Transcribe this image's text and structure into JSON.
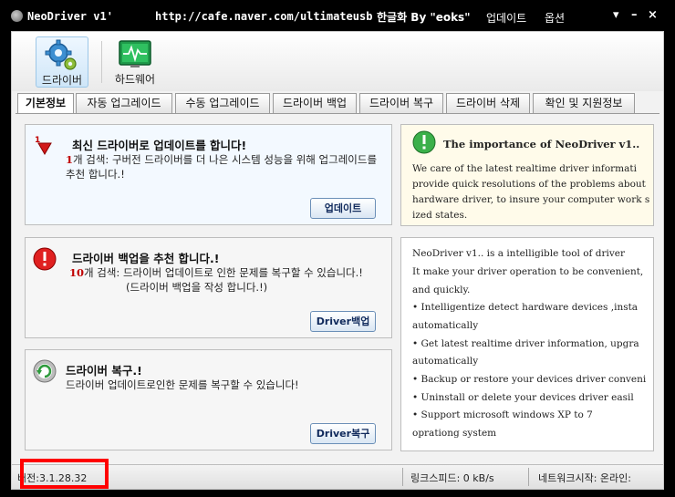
{
  "titlebar": {
    "app_name": "NeoDriver v1'",
    "url": "http://cafe.naver.com/ultimateusb",
    "credit": "한글화 By \"eoks\"",
    "menu_update": "업데이트",
    "menu_options": "옵션",
    "minimize_glyph": "▾",
    "dash_glyph": "–",
    "close_glyph": "×"
  },
  "toolbar": {
    "driver_label": "드라이버",
    "hardware_label": "하드웨어"
  },
  "tabs": [
    {
      "label": "기본정보",
      "active": true
    },
    {
      "label": "자동 업그레이드",
      "active": false
    },
    {
      "label": "수동 업그레이드",
      "active": false
    },
    {
      "label": "드라이버 백업",
      "active": false
    },
    {
      "label": "드라이버 복구",
      "active": false
    },
    {
      "label": "드라이버 삭제",
      "active": false
    },
    {
      "label": "확인 및 지원정보",
      "active": false
    }
  ],
  "update_panel": {
    "title": "최신 드라이버로 업데이트를 합니다!",
    "count": "1",
    "desc": "개 검색: 구버전 드라이버를 더 나은 시스템 성능을 위해 업그레이드를 추천 합니다.!",
    "button": "업데이트"
  },
  "backup_panel": {
    "title": "드라이버 백업을 추천 합니다.!",
    "count": "10",
    "desc1": "개 검색: 드라이버 업데이트로 인한 문제를 복구할 수 있습니다.!",
    "desc2": "(드라이버 백업을 작성 합니다.!)",
    "button": "Driver백업"
  },
  "restore_panel": {
    "title": "드라이버 복구.!",
    "desc": "드라이버 업데이트로인한 문제를 복구할 수 있습니다!",
    "button": "Driver복구"
  },
  "importance_panel": {
    "title": "The importance of NeoDriver v1..",
    "lines": [
      "We care of the latest realtime driver informati",
      "provide quick resolutions of the problems about",
      "hardware driver, to insure your computer work s",
      "ized states."
    ]
  },
  "features_panel": {
    "lines": [
      "NeoDriver v1.. is a intelligible tool of driver",
      "It make your driver operation to be convenient,",
      "and quickly.",
      "• Intelligentize detect hardware devices ,insta",
      "automatically",
      "• Get latest realtime driver information, upgra",
      "automatically",
      "• Backup or restore your devices driver conveni",
      "• Uninstall or delete your devices driver easil",
      "• Support microsoft windows XP to 7",
      "oprationg system"
    ]
  },
  "statusbar": {
    "version": "버전:3.1.28.32",
    "link_speed": "링크스피드: 0 kB/s",
    "network": "네트워크시작: 온라인:"
  },
  "colors": {
    "accent_red": "#ff0000",
    "count_red": "#c00000",
    "tab_border": "#9a9a9a",
    "importance_bg": "#fffbea"
  }
}
